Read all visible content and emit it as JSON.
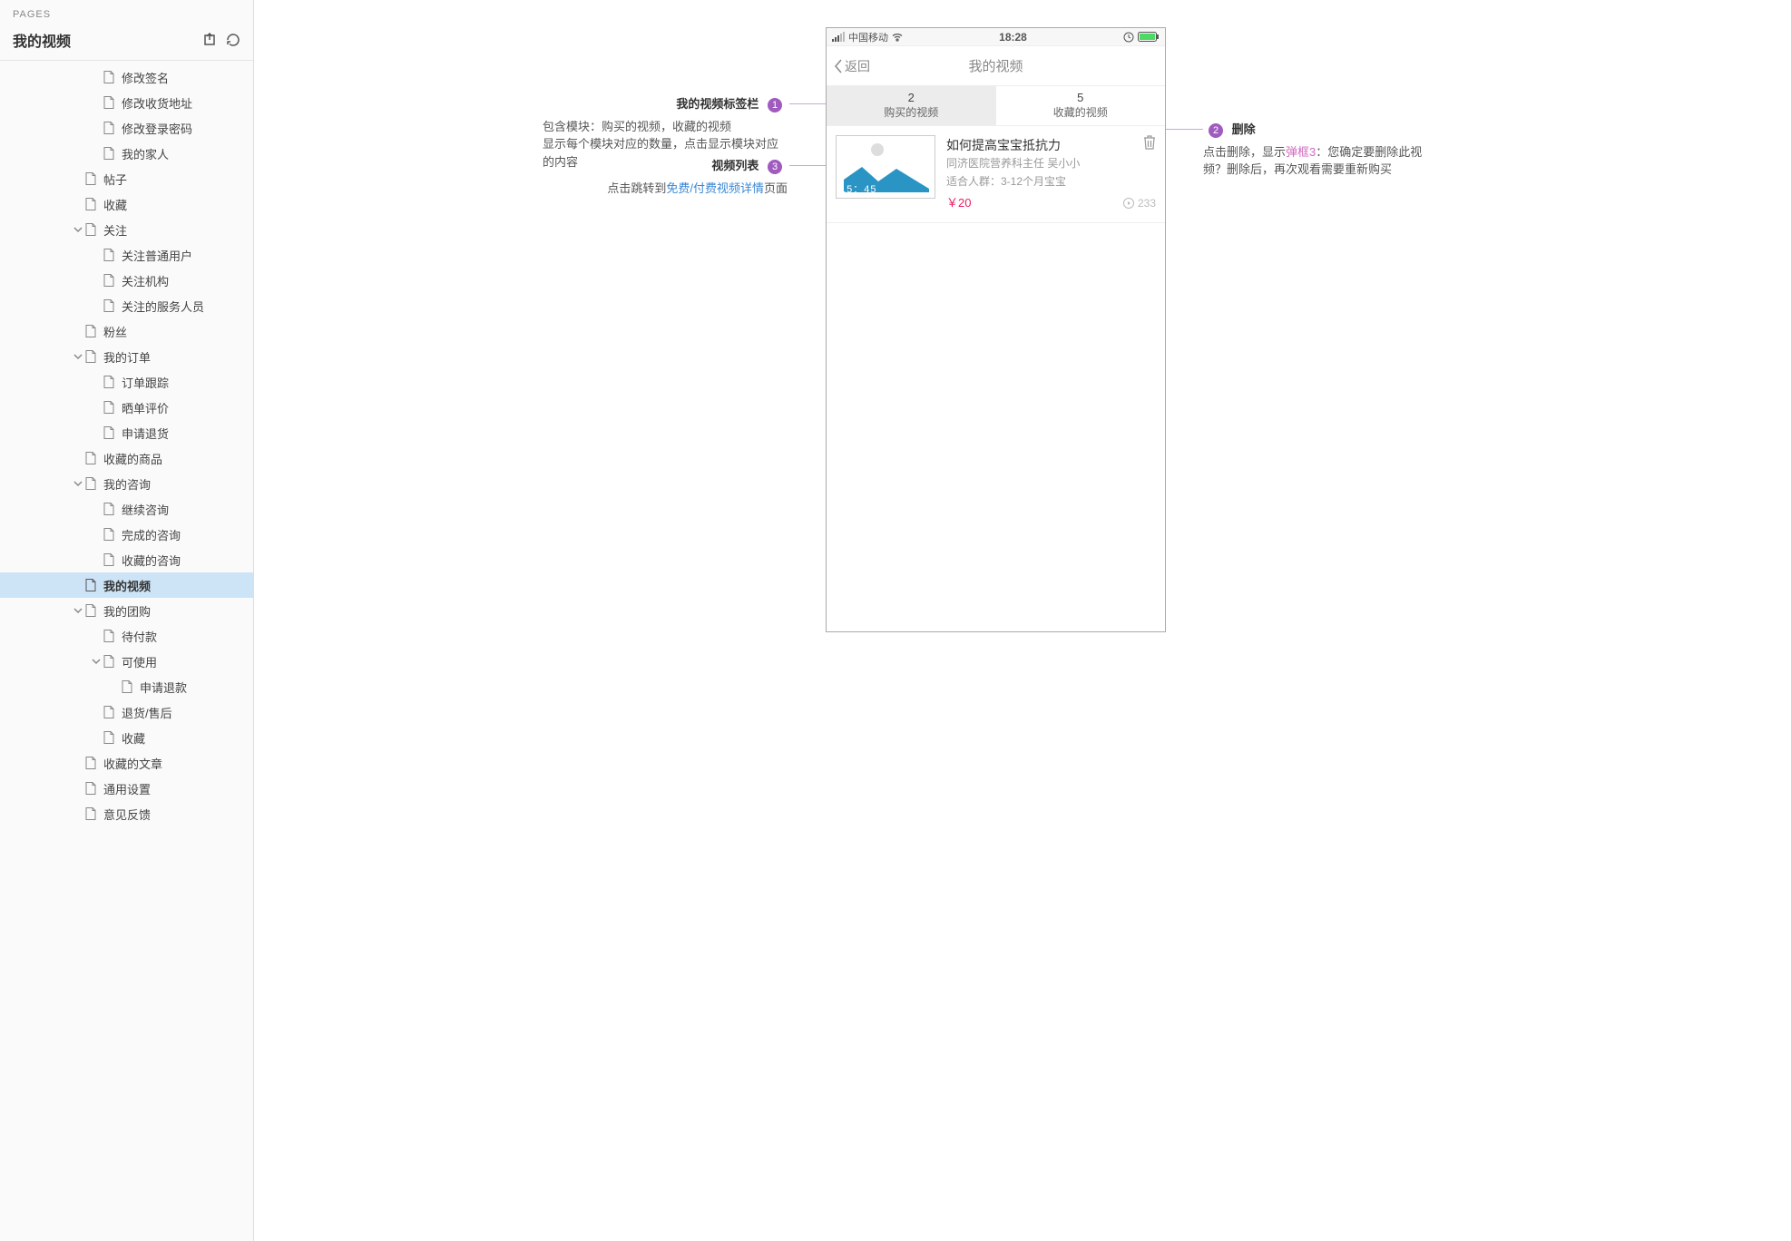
{
  "sidebar": {
    "header_label": "PAGES",
    "title": "我的视频",
    "tree": [
      {
        "label": "修改签名",
        "indent": 5
      },
      {
        "label": "修改收货地址",
        "indent": 5
      },
      {
        "label": "修改登录密码",
        "indent": 5
      },
      {
        "label": "我的家人",
        "indent": 5
      },
      {
        "label": "帖子",
        "indent": 4
      },
      {
        "label": "收藏",
        "indent": 4
      },
      {
        "label": "关注",
        "indent": 4,
        "expander": "down"
      },
      {
        "label": "关注普通用户",
        "indent": 5
      },
      {
        "label": "关注机构",
        "indent": 5
      },
      {
        "label": "关注的服务人员",
        "indent": 5
      },
      {
        "label": "粉丝",
        "indent": 4
      },
      {
        "label": "我的订单",
        "indent": 4,
        "expander": "down"
      },
      {
        "label": "订单跟踪",
        "indent": 5
      },
      {
        "label": "晒单评价",
        "indent": 5
      },
      {
        "label": "申请退货",
        "indent": 5
      },
      {
        "label": "收藏的商品",
        "indent": 4
      },
      {
        "label": "我的咨询",
        "indent": 4,
        "expander": "down"
      },
      {
        "label": "继续咨询",
        "indent": 5
      },
      {
        "label": "完成的咨询",
        "indent": 5
      },
      {
        "label": "收藏的咨询",
        "indent": 5
      },
      {
        "label": "我的视频",
        "indent": 4,
        "selected": true
      },
      {
        "label": "我的团购",
        "indent": 4,
        "expander": "down"
      },
      {
        "label": "待付款",
        "indent": 5
      },
      {
        "label": "可使用",
        "indent": 5,
        "expander": "down"
      },
      {
        "label": "申请退款",
        "indent": 6
      },
      {
        "label": "退货/售后",
        "indent": 5
      },
      {
        "label": "收藏",
        "indent": 5
      },
      {
        "label": "收藏的文章",
        "indent": 4
      },
      {
        "label": "通用设置",
        "indent": 4
      },
      {
        "label": "意见反馈",
        "indent": 4
      }
    ]
  },
  "phone": {
    "statusbar": {
      "carrier": "中国移动",
      "time": "18:28"
    },
    "navbar": {
      "back": "返回",
      "title": "我的视频"
    },
    "tabs": [
      {
        "count": "2",
        "label": "购买的视频",
        "active": true
      },
      {
        "count": "5",
        "label": "收藏的视频",
        "active": false
      }
    ],
    "video": {
      "duration": "15：45",
      "title": "如何提高宝宝抵抗力",
      "author": "同济医院营养科主任  吴小小",
      "audience": "适合人群：3-12个月宝宝",
      "price": "￥20",
      "plays": "233"
    }
  },
  "annotations": {
    "a1": {
      "title": "我的视频标签栏",
      "desc_1": "包含模块：购买的视频，收藏的视频",
      "desc_2": "显示每个模块对应的数量，点击显示模块对应的内容"
    },
    "a3": {
      "title": "视频列表",
      "desc_prefix": "点击跳转到",
      "desc_link": "免费/付费视频详情",
      "desc_suffix": "页面"
    },
    "a2": {
      "title": "删除",
      "desc_prefix": "点击删除，显示",
      "desc_link": "弹框3",
      "desc_suffix": "：您确定要删除此视频？删除后，再次观看需要重新购买"
    },
    "marker1": "1",
    "marker2": "2",
    "marker3": "3"
  }
}
